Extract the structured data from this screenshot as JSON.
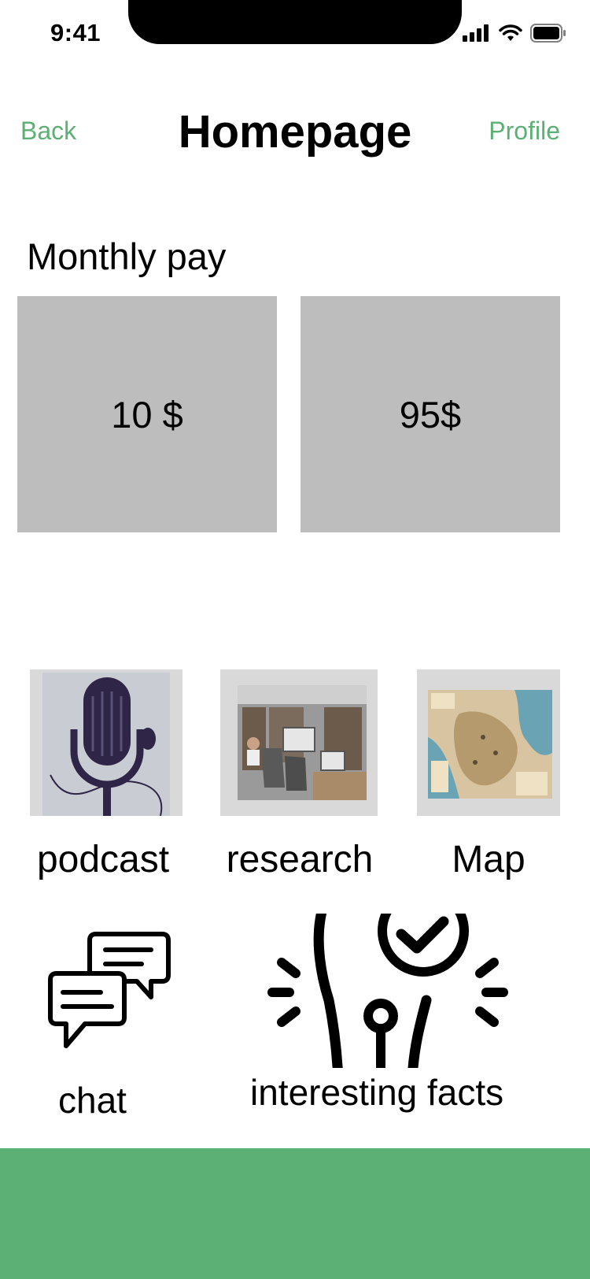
{
  "status_bar": {
    "time": "9:41"
  },
  "nav": {
    "back_label": "Back",
    "title": "Homepage",
    "profile_label": "Profile"
  },
  "monthly_pay": {
    "title": "Monthly pay",
    "plans": [
      {
        "price": "10 $"
      },
      {
        "price": "95$"
      }
    ]
  },
  "features": [
    {
      "label": "podcast",
      "icon": "microphone-image"
    },
    {
      "label": "research",
      "icon": "research-office-image"
    },
    {
      "label": "Map",
      "icon": "map-image"
    }
  ],
  "extras": [
    {
      "label": "chat",
      "icon": "chat-bubbles-icon"
    },
    {
      "label": "interesting facts",
      "icon": "lightbulb-check-icon"
    }
  ],
  "colors": {
    "accent": "#5db075",
    "card": "#bdbdbd",
    "tile": "#d9d9d9"
  }
}
